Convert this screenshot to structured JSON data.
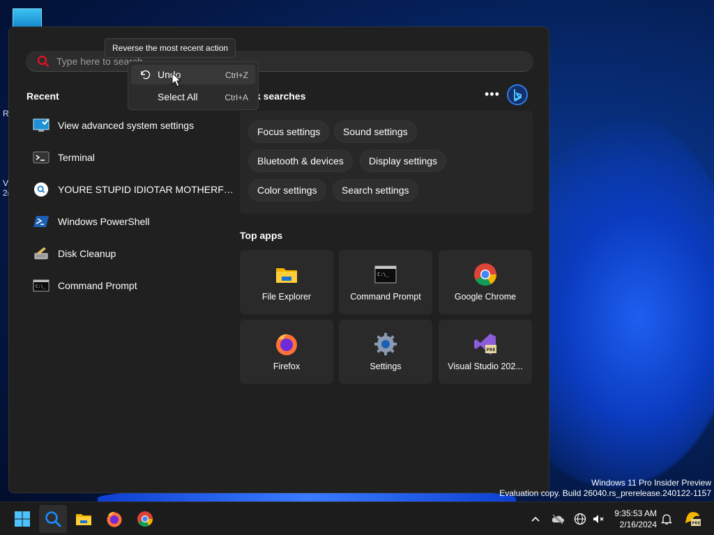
{
  "desktop": {
    "fragments": [
      "R",
      "V",
      "2("
    ]
  },
  "search": {
    "placeholder": "Type here to search"
  },
  "tooltip": {
    "text": "Reverse the most recent action"
  },
  "context_menu": {
    "items": [
      {
        "label": "Undo",
        "shortcut": "Ctrl+Z",
        "icon": "undo-icon"
      },
      {
        "label": "Select All",
        "shortcut": "Ctrl+A",
        "icon": ""
      }
    ]
  },
  "recent": {
    "title": "Recent",
    "items": [
      {
        "label": "View advanced system settings",
        "icon": "system-settings-icon"
      },
      {
        "label": "Terminal",
        "icon": "terminal-icon"
      },
      {
        "label": "YOURE STUPID IDIOTAR MOTHERFUCK...",
        "icon": "search-icon"
      },
      {
        "label": "Windows PowerShell",
        "icon": "powershell-icon"
      },
      {
        "label": "Disk Cleanup",
        "icon": "disk-cleanup-icon"
      },
      {
        "label": "Command Prompt",
        "icon": "command-prompt-icon"
      }
    ]
  },
  "quick_searches": {
    "title": "k searches",
    "chips": [
      "Focus settings",
      "Sound settings",
      "Bluetooth & devices",
      "Display settings",
      "Color settings",
      "Search settings"
    ]
  },
  "top_apps": {
    "title": "Top apps",
    "apps": [
      {
        "label": "File Explorer",
        "icon": "folder-icon"
      },
      {
        "label": "Command Prompt",
        "icon": "command-prompt-icon"
      },
      {
        "label": "Google Chrome",
        "icon": "chrome-icon"
      },
      {
        "label": "Firefox",
        "icon": "firefox-icon"
      },
      {
        "label": "Settings",
        "icon": "gear-icon"
      },
      {
        "label": "Visual Studio 202...",
        "icon": "visual-studio-icon"
      }
    ]
  },
  "watermark": {
    "line1": "Windows 11 Pro Insider Preview",
    "line2": "Evaluation copy. Build 26040.rs_prerelease.240122-1157"
  },
  "taskbar": {
    "time": "9:35:53 AM",
    "date": "2/16/2024"
  },
  "colors": {
    "accent": "#4cc2ff",
    "search_red": "#e81123",
    "panel": "#202020"
  }
}
